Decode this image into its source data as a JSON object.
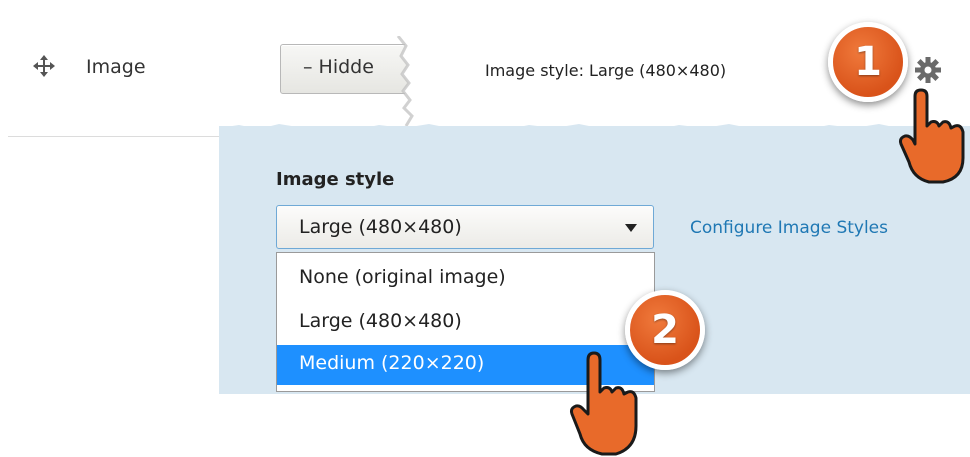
{
  "field": {
    "label": "Image",
    "move_icon": "move-cross-icon",
    "format_button_label": "– Hidde",
    "summary": "Image style: Large (480×480)",
    "gear_icon": "gear-icon"
  },
  "annotations": {
    "step1": "1",
    "step2": "2",
    "badge_color": "#e0622a"
  },
  "settings": {
    "image_style_label": "Image style",
    "selected": "Large (480×480)",
    "configure_link": "Configure Image Styles",
    "options": [
      {
        "label": "None (original image)"
      },
      {
        "label": "Large (480×480)"
      },
      {
        "label": "Medium (220×220)",
        "highlighted": true
      }
    ],
    "panel_color": "#d8e7f1",
    "link_color": "#1f78b4",
    "highlight_color": "#1e90ff"
  }
}
